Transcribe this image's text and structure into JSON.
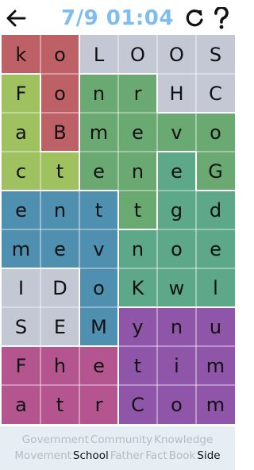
{
  "header": {
    "back_icon": "back-arrow-icon",
    "title": "7/9 01:04",
    "restart_icon": "restart-icon",
    "help_icon": "help-icon"
  },
  "grid": {
    "rows": [
      [
        "k",
        "o",
        "L",
        "O",
        "O",
        "S"
      ],
      [
        "F",
        "o",
        "n",
        "r",
        "H",
        "C"
      ],
      [
        "a",
        "B",
        "m",
        "e",
        "v",
        "o"
      ],
      [
        "c",
        "t",
        "e",
        "n",
        "e",
        "G"
      ],
      [
        "e",
        "n",
        "t",
        "t",
        "g",
        "d"
      ],
      [
        "m",
        "e",
        "v",
        "n",
        "o",
        "e"
      ],
      [
        "I",
        "D",
        "o",
        "K",
        "w",
        "l"
      ],
      [
        "S",
        "E",
        "M",
        "y",
        "n",
        "u"
      ],
      [
        "F",
        "h",
        "e",
        "t",
        "i",
        "m"
      ],
      [
        "a",
        "t",
        "r",
        "C",
        "o",
        "m"
      ]
    ],
    "colors": [
      [
        "#be6167",
        "#be6167",
        "#c4c7d4",
        "#c4c7d4",
        "#c4c7d4",
        "#c4c7d4"
      ],
      [
        "#9fc160",
        "#be6167",
        "#6aa971",
        "#6aa971",
        "#c4c7d4",
        "#c4c7d4"
      ],
      [
        "#9fc160",
        "#be6167",
        "#6aa971",
        "#6aa971",
        "#6aa971",
        "#6aa971"
      ],
      [
        "#9fc160",
        "#9fc160",
        "#6aa971",
        "#6aa971",
        "#5ea88a",
        "#6aa971"
      ],
      [
        "#4f8fb0",
        "#4f8fb0",
        "#4f8fb0",
        "#6aa971",
        "#5ea88a",
        "#5ea88a"
      ],
      [
        "#4f8fb0",
        "#4f8fb0",
        "#4f8fb0",
        "#5ea88a",
        "#5ea88a",
        "#5ea88a"
      ],
      [
        "#c4c7d4",
        "#c4c7d4",
        "#4f8fb0",
        "#5ea88a",
        "#5ea88a",
        "#5ea88a"
      ],
      [
        "#c4c7d4",
        "#c4c7d4",
        "#4f8fb0",
        "#8f55a8",
        "#8f55a8",
        "#8f55a8"
      ],
      [
        "#b45590",
        "#b45590",
        "#b45590",
        "#8f55a8",
        "#8f55a8",
        "#8f55a8"
      ],
      [
        "#b45590",
        "#b45590",
        "#b45590",
        "#8f55a8",
        "#8f55a8",
        "#8f55a8"
      ]
    ]
  },
  "words": [
    {
      "text": "Government",
      "found": true
    },
    {
      "text": "Community",
      "found": true
    },
    {
      "text": "Knowledge",
      "found": true
    },
    {
      "text": "Movement",
      "found": true
    },
    {
      "text": "School",
      "found": false
    },
    {
      "text": "Father",
      "found": true
    },
    {
      "text": "Fact",
      "found": true
    },
    {
      "text": "Book",
      "found": true
    },
    {
      "text": "Side",
      "found": false
    }
  ]
}
